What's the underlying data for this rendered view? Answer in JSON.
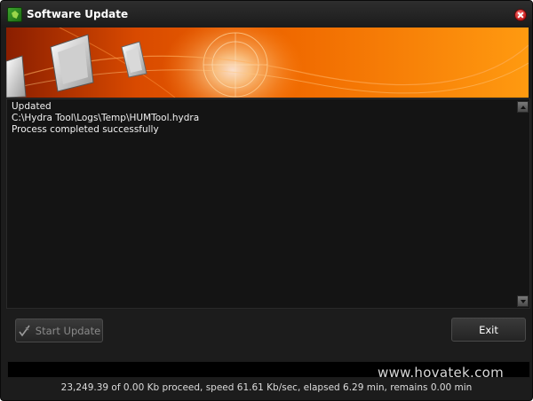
{
  "window": {
    "title": "Software Update",
    "app_icon": "hydra-app-icon",
    "close_icon": "close-icon"
  },
  "log": {
    "lines": [
      "Updated",
      "C:\\Hydra Tool\\Logs\\Temp\\HUMTool.hydra",
      "Process completed successfully"
    ]
  },
  "buttons": {
    "start_update": "Start Update",
    "start_update_icon": "pen-check-icon",
    "exit": "Exit"
  },
  "progress": {
    "fraction": 0
  },
  "watermark": "www.hovatek.com",
  "status": "23,249.39 of 0.00 Kb proceed, speed 61.61 Kb/sec, elapsed 6.29 min, remains 0.00 min",
  "colors": {
    "background": "#1c1c1c",
    "banner_orange": "#f06a00",
    "text": "#f2f2f2"
  }
}
